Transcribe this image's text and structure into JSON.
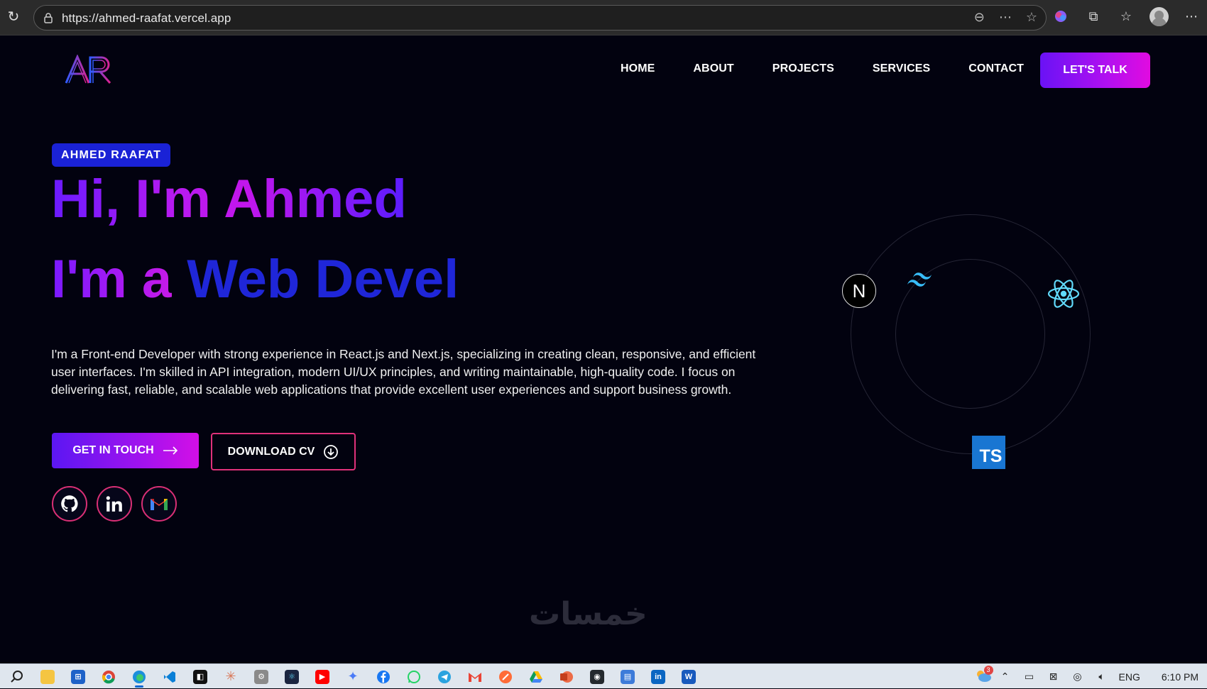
{
  "browser": {
    "url": "https://ahmed-raafat.vercel.app",
    "icons": [
      "reload-icon",
      "lock-icon",
      "zoom-out-icon",
      "more-options-icon",
      "favorite-star-icon",
      "copilot-icon",
      "extensions-icon",
      "collections-icon",
      "profile-avatar",
      "menu-ellipsis-icon"
    ]
  },
  "site": {
    "logo_text": "AR",
    "nav": [
      "HOME",
      "ABOUT",
      "PROJECTS",
      "SERVICES",
      "CONTACT"
    ],
    "cta": "LET'S TALK"
  },
  "hero": {
    "badge": "AHMED RAAFAT",
    "heading1": "Hi, I'm Ahmed",
    "heading2_prefix": "I'm a",
    "heading2_typed": "Web Devel",
    "bio": "I'm a Front-end Developer with strong experience in React.js and Next.js, specializing in creating clean, responsive, and efficient user interfaces. I'm skilled in API integration, modern UI/UX principles, and writing maintainable, high-quality code. I focus on delivering fast, reliable, and scalable web applications that provide excellent user experiences and support business growth.",
    "btn_touch": "GET IN TOUCH",
    "btn_cv": "DOWNLOAD CV",
    "socials": [
      "github-icon",
      "linkedin-icon",
      "gmail-icon"
    ],
    "tech_icons": [
      "nextjs-icon",
      "tailwind-icon",
      "react-icon",
      "typescript-icon"
    ],
    "ts_label": "TS",
    "next_label": "N"
  },
  "watermark": "خمسات",
  "taskbar": {
    "apps": [
      "search",
      "file-explorer",
      "store",
      "chrome",
      "edge",
      "vscode",
      "capcut",
      "claude",
      "settings",
      "react-devtools",
      "youtube",
      "gemini",
      "facebook",
      "whatsapp",
      "telegram",
      "gmail",
      "postman",
      "google-drive",
      "powerpoint",
      "github-desktop",
      "remote",
      "linkedin",
      "word"
    ],
    "notification_count": "3",
    "lang": "ENG",
    "time": "6:10 PM"
  },
  "colors": {
    "accent_purple": "#a612ee",
    "accent_blue": "#1f26d8",
    "border_pink": "#d92f75",
    "bg": "#02020f"
  }
}
